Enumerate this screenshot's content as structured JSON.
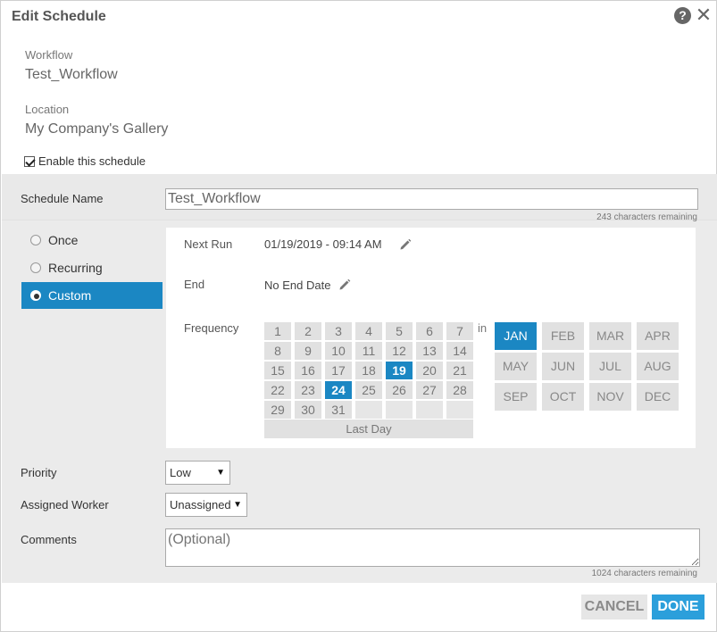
{
  "dialog": {
    "title": "Edit Schedule",
    "help_icon": "?",
    "close_icon": "✕"
  },
  "info": {
    "workflow_label": "Workflow",
    "workflow_value": "Test_Workflow",
    "location_label": "Location",
    "location_value": "My Company's Gallery",
    "enable_label": "Enable this schedule",
    "enable_checked": true
  },
  "schedule_name": {
    "label": "Schedule Name",
    "value": "Test_Workflow",
    "chars_remaining": "243 characters remaining"
  },
  "schedule_type": {
    "options": [
      "Once",
      "Recurring",
      "Custom"
    ],
    "selected": "Custom"
  },
  "custom": {
    "next_run_label": "Next Run",
    "next_run_value": "01/19/2019 - 09:14 AM",
    "end_label": "End",
    "end_value": "No End Date",
    "frequency_label": "Frequency",
    "in_label": "in",
    "days": [
      "1",
      "2",
      "3",
      "4",
      "5",
      "6",
      "7",
      "8",
      "9",
      "10",
      "11",
      "12",
      "13",
      "14",
      "15",
      "16",
      "17",
      "18",
      "19",
      "20",
      "21",
      "22",
      "23",
      "24",
      "25",
      "26",
      "27",
      "28",
      "29",
      "30",
      "31"
    ],
    "selected_days": [
      "19",
      "24"
    ],
    "last_day_label": "Last Day",
    "months": [
      "JAN",
      "FEB",
      "MAR",
      "APR",
      "MAY",
      "JUN",
      "JUL",
      "AUG",
      "SEP",
      "OCT",
      "NOV",
      "DEC"
    ],
    "selected_months": [
      "JAN"
    ]
  },
  "priority": {
    "label": "Priority",
    "value": "Low"
  },
  "worker": {
    "label": "Assigned Worker",
    "value": "Unassigned"
  },
  "comments": {
    "label": "Comments",
    "placeholder": "(Optional)",
    "chars_remaining": "1024 characters remaining"
  },
  "buttons": {
    "cancel": "CANCEL",
    "done": "DONE"
  },
  "colors": {
    "accent": "#1b87c3",
    "done_button": "#2b9fdb"
  }
}
